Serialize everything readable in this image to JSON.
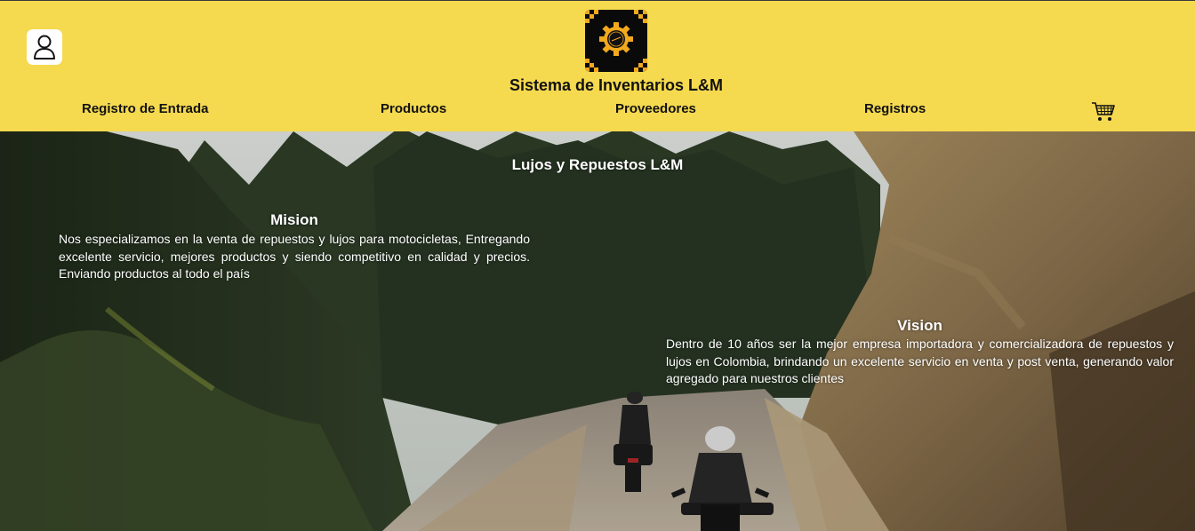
{
  "header": {
    "brand_title": "Sistema de Inventarios L&M",
    "user_icon": "user-icon",
    "logo_icon": "gear-logo",
    "cart_icon": "shopping-cart-icon",
    "background_color": "#f5d94f"
  },
  "nav": {
    "items": [
      {
        "label": "Registro de Entrada"
      },
      {
        "label": "Productos"
      },
      {
        "label": "Proveedores"
      },
      {
        "label": "Registros"
      }
    ]
  },
  "hero": {
    "title": "Lujos y Repuestos L&M",
    "mision": {
      "title": "Mision",
      "text": "Nos especializamos en la venta de repuestos y lujos para motocicletas, Entregando excelente servicio, mejores productos y siendo competitivo en calidad y precios. Enviando productos al todo el país"
    },
    "vision": {
      "title": "Vision",
      "text": "Dentro de 10 años ser la mejor empresa importadora y comercializadora de repuestos y lujos en Colombia, brindando un excelente servicio en venta y post venta, generando valor agregado para nuestros clientes"
    }
  }
}
